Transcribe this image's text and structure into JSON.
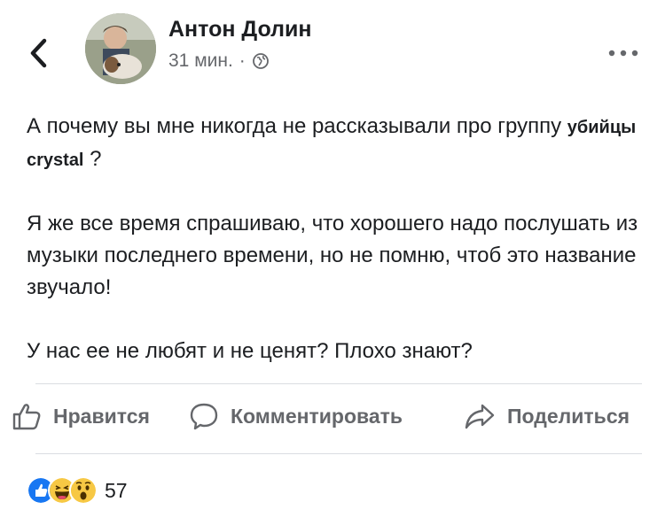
{
  "header": {
    "author_name": "Антон Долин",
    "timestamp": "31 мин.",
    "separator": "·",
    "privacy_icon": "globe-icon"
  },
  "post": {
    "p1_text": "А почему вы мне никогда не рассказывали про группу ",
    "p1_bold": "убийцы crystal",
    "p1_end": " ?",
    "p2": "Я же все время спрашиваю, что хорошего надо послушать из музыки последнего времени, но не помню, чтоб это название звучало!",
    "p3": "У нас ее не любят и не ценят? Плохо знают?"
  },
  "actions": {
    "like_label": "Нравится",
    "comment_label": "Комментировать",
    "share_label": "Поделиться"
  },
  "reactions": {
    "icons": [
      "like-reaction-icon",
      "haha-reaction-icon",
      "wow-reaction-icon"
    ],
    "count": "57"
  },
  "colors": {
    "text": "#1c1e21",
    "secondary": "#65676b",
    "like_blue": "#1877f2",
    "reaction_yellow": "#f7c844",
    "divider": "#dadde1"
  }
}
